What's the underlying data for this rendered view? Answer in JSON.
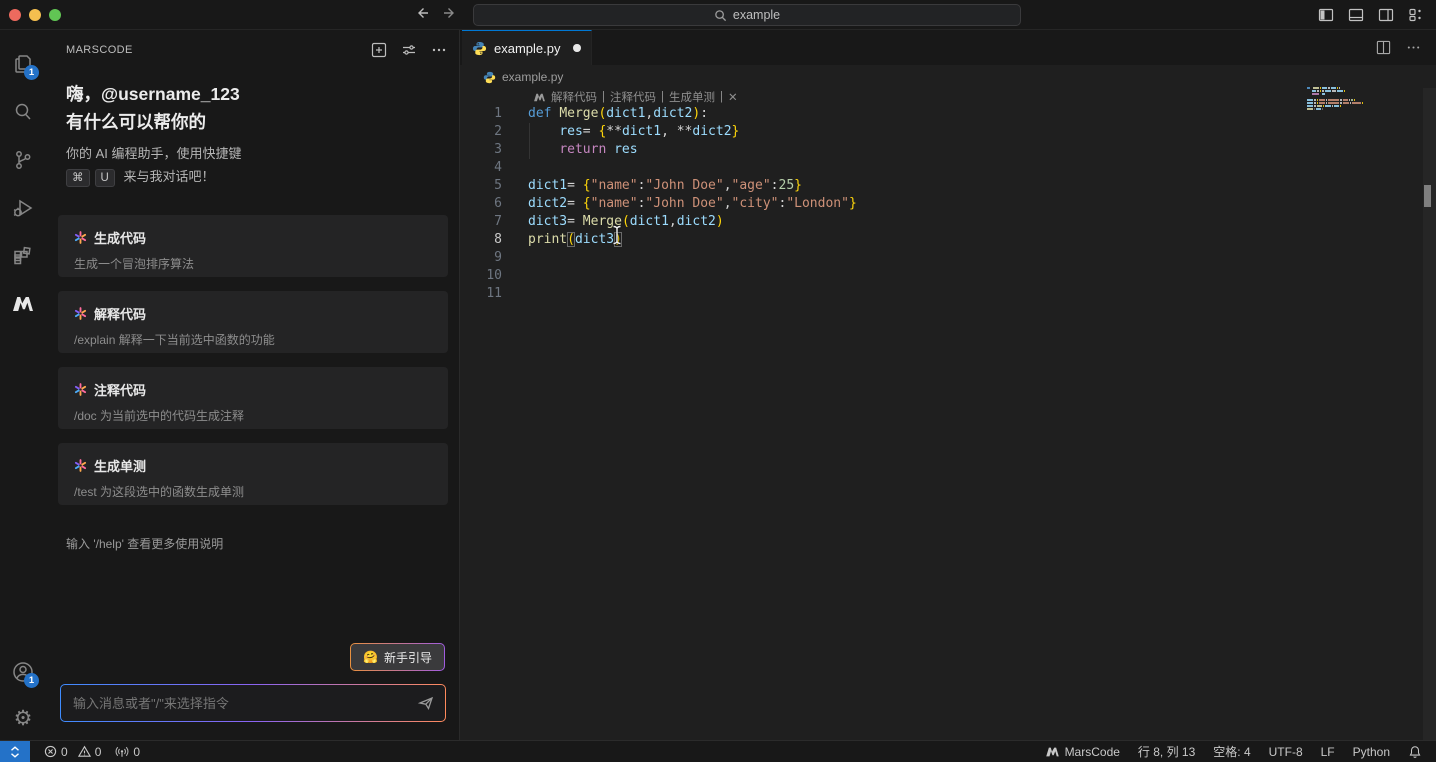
{
  "colors": {
    "accent_blue": "#2472c8",
    "tab_accent": "#0078d4",
    "traffic_close": "#ed6a5e",
    "traffic_minimize": "#f5bf4f",
    "traffic_zoom": "#61c554",
    "editor_bg": "#1f1f1f",
    "panel_bg": "#181818"
  },
  "titlebar": {
    "search_value": "example"
  },
  "activity_bar": {
    "explorer_badge": "1",
    "account_badge": "1"
  },
  "sidebar": {
    "title": "MARSCODE",
    "greeting_line1": "嗨，@username_123",
    "greeting_line2": "有什么可以帮你的",
    "assist_line1": "你的 AI 编程助手，使用快捷键",
    "kbd_cmd": "⌘",
    "kbd_key": "U",
    "assist_line2": "来与我对话吧！",
    "cards": [
      {
        "title": "生成代码",
        "desc": "生成一个冒泡排序算法"
      },
      {
        "title": "解释代码",
        "desc": "/explain 解释一下当前选中函数的功能"
      },
      {
        "title": "注释代码",
        "desc": "/doc 为当前选中的代码生成注释"
      },
      {
        "title": "生成单测",
        "desc": "/test 为这段选中的函数生成单测"
      }
    ],
    "help_text": "输入 '/help' 查看更多使用说明",
    "guide_emoji": "🤗",
    "guide_label": "新手引导",
    "input_placeholder": "输入消息或者\"/\"来选择指令"
  },
  "editor": {
    "tab_label": "example.py",
    "breadcrumb": "example.py",
    "codelens": {
      "items": [
        "解释代码",
        "注释代码",
        "生成单测"
      ],
      "separator": "|",
      "close": "✕"
    }
  },
  "code": {
    "lines": [
      {
        "n": "1",
        "tokens": [
          [
            "kw",
            "def"
          ],
          [
            "pln",
            " "
          ],
          [
            "fn",
            "Merge"
          ],
          [
            "br",
            "("
          ],
          [
            "vr",
            "dict1"
          ],
          [
            "pln",
            ","
          ],
          [
            "vr",
            "dict2"
          ],
          [
            "br",
            ")"
          ],
          [
            "pln",
            ":"
          ]
        ]
      },
      {
        "n": "2",
        "tokens": [
          [
            "pln",
            "    "
          ],
          [
            "vr",
            "res"
          ],
          [
            "pln",
            "= "
          ],
          [
            "br",
            "{"
          ],
          [
            "pln",
            "**"
          ],
          [
            "vr",
            "dict1"
          ],
          [
            "pln",
            ", **"
          ],
          [
            "vr",
            "dict2"
          ],
          [
            "br",
            "}"
          ]
        ]
      },
      {
        "n": "3",
        "tokens": [
          [
            "pln",
            "    "
          ],
          [
            "ctl",
            "return"
          ],
          [
            "pln",
            " "
          ],
          [
            "vr",
            "res"
          ]
        ]
      },
      {
        "n": "4",
        "tokens": []
      },
      {
        "n": "5",
        "tokens": [
          [
            "vr",
            "dict1"
          ],
          [
            "pln",
            "= "
          ],
          [
            "br",
            "{"
          ],
          [
            "str",
            "\"name\""
          ],
          [
            "pln",
            ":"
          ],
          [
            "str",
            "\"John Doe\""
          ],
          [
            "pln",
            ","
          ],
          [
            "str",
            "\"age\""
          ],
          [
            "pln",
            ":"
          ],
          [
            "num",
            "25"
          ],
          [
            "br",
            "}"
          ]
        ]
      },
      {
        "n": "6",
        "tokens": [
          [
            "vr",
            "dict2"
          ],
          [
            "pln",
            "= "
          ],
          [
            "br",
            "{"
          ],
          [
            "str",
            "\"name\""
          ],
          [
            "pln",
            ":"
          ],
          [
            "str",
            "\"John Doe\""
          ],
          [
            "pln",
            ","
          ],
          [
            "str",
            "\"city\""
          ],
          [
            "pln",
            ":"
          ],
          [
            "str",
            "\"London\""
          ],
          [
            "br",
            "}"
          ]
        ]
      },
      {
        "n": "7",
        "tokens": [
          [
            "vr",
            "dict3"
          ],
          [
            "pln",
            "= "
          ],
          [
            "fn",
            "Merge"
          ],
          [
            "br",
            "("
          ],
          [
            "vr",
            "dict1"
          ],
          [
            "pln",
            ","
          ],
          [
            "vr",
            "dict2"
          ],
          [
            "br",
            ")"
          ]
        ]
      },
      {
        "n": "8",
        "active": true,
        "tokens": [
          [
            "fn",
            "print"
          ],
          [
            "brm",
            "("
          ],
          [
            "vr",
            "dict3"
          ],
          [
            "brm",
            ")"
          ]
        ]
      },
      {
        "n": "9",
        "tokens": []
      },
      {
        "n": "10",
        "tokens": []
      },
      {
        "n": "11",
        "tokens": []
      }
    ]
  },
  "status_bar": {
    "errors": "0",
    "warnings": "0",
    "ports": "0",
    "marscode": "MarsCode",
    "cursor_position": "行 8, 列 13",
    "indentation": "空格: 4",
    "encoding": "UTF-8",
    "eol": "LF",
    "language": "Python"
  }
}
